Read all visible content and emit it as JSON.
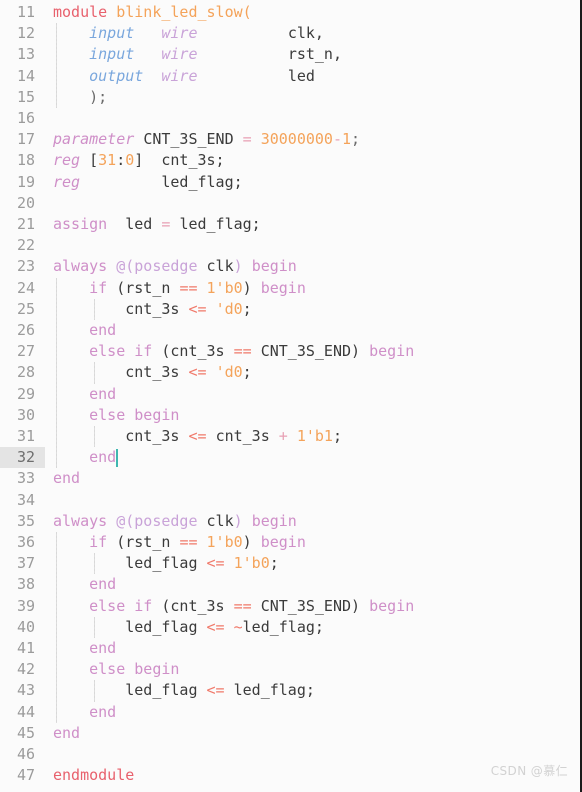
{
  "editor": {
    "language": "verilog",
    "first_line_number": 11,
    "active_line_number": 32,
    "line_height_px": 21.2,
    "background_color": "#fbfbfb",
    "gutter_color": "#fbfbfb",
    "line_number_color": "#9b9b9b",
    "active_line_gutter_color": "#e4e4e4",
    "caret_color": "#3fb7b0",
    "indent_guide_color": "#d8d8d8"
  },
  "palette": {
    "module_keyword": "#e8616d",
    "module_name": "#f4a35a",
    "keyword": "#cf8fc8",
    "declaration": "#cf8fc8",
    "port_direction": "#7aa7dd",
    "net_type": "#c9a3d8",
    "identifier": "#3b3b3b",
    "number": "#f4a35a",
    "operator": "#f0796a",
    "assign_equals": "#e8a0b4",
    "punctuation": "#6a6a6a"
  },
  "watermark": {
    "text": "CSDN @慕仁"
  },
  "lines": [
    {
      "n": 11,
      "text": "module blink_led_slow("
    },
    {
      "n": 12,
      "text": "    input   wire          clk,"
    },
    {
      "n": 13,
      "text": "    input   wire          rst_n,"
    },
    {
      "n": 14,
      "text": "    output  wire          led"
    },
    {
      "n": 15,
      "text": "    );"
    },
    {
      "n": 16,
      "text": ""
    },
    {
      "n": 17,
      "text": "parameter CNT_3S_END = 30000000-1;"
    },
    {
      "n": 18,
      "text": "reg [31:0]  cnt_3s;"
    },
    {
      "n": 19,
      "text": "reg         led_flag;"
    },
    {
      "n": 20,
      "text": ""
    },
    {
      "n": 21,
      "text": "assign  led = led_flag;"
    },
    {
      "n": 22,
      "text": ""
    },
    {
      "n": 23,
      "text": "always @(posedge clk) begin"
    },
    {
      "n": 24,
      "text": "    if (rst_n == 1'b0) begin"
    },
    {
      "n": 25,
      "text": "        cnt_3s <= 'd0;"
    },
    {
      "n": 26,
      "text": "    end"
    },
    {
      "n": 27,
      "text": "    else if (cnt_3s == CNT_3S_END) begin"
    },
    {
      "n": 28,
      "text": "        cnt_3s <= 'd0;"
    },
    {
      "n": 29,
      "text": "    end"
    },
    {
      "n": 30,
      "text": "    else begin"
    },
    {
      "n": 31,
      "text": "        cnt_3s <= cnt_3s + 1'b1;"
    },
    {
      "n": 32,
      "text": "    end"
    },
    {
      "n": 33,
      "text": "end"
    },
    {
      "n": 34,
      "text": ""
    },
    {
      "n": 35,
      "text": "always @(posedge clk) begin"
    },
    {
      "n": 36,
      "text": "    if (rst_n == 1'b0) begin"
    },
    {
      "n": 37,
      "text": "        led_flag <= 1'b0;"
    },
    {
      "n": 38,
      "text": "    end"
    },
    {
      "n": 39,
      "text": "    else if (cnt_3s == CNT_3S_END) begin"
    },
    {
      "n": 40,
      "text": "        led_flag <= ~led_flag;"
    },
    {
      "n": 41,
      "text": "    end"
    },
    {
      "n": 42,
      "text": "    else begin"
    },
    {
      "n": 43,
      "text": "        led_flag <= led_flag;"
    },
    {
      "n": 44,
      "text": "    end"
    },
    {
      "n": 45,
      "text": "end"
    },
    {
      "n": 46,
      "text": ""
    },
    {
      "n": 47,
      "text": "endmodule"
    }
  ],
  "tokens": {
    "11": [
      [
        "module ",
        "k-mod"
      ],
      [
        "blink_led_slow",
        "k-name"
      ],
      [
        "(",
        "k-name"
      ]
    ],
    "12": [
      [
        "    ",
        ""
      ],
      [
        "input",
        "k-port"
      ],
      [
        "   ",
        ""
      ],
      [
        "wire",
        "k-type"
      ],
      [
        "          ",
        ""
      ],
      [
        "clk,",
        "k-id"
      ]
    ],
    "13": [
      [
        "    ",
        ""
      ],
      [
        "input",
        "k-port"
      ],
      [
        "   ",
        ""
      ],
      [
        "wire",
        "k-type"
      ],
      [
        "          ",
        ""
      ],
      [
        "rst_n,",
        "k-id"
      ]
    ],
    "14": [
      [
        "    ",
        ""
      ],
      [
        "output",
        "k-port"
      ],
      [
        "  ",
        ""
      ],
      [
        "wire",
        "k-type"
      ],
      [
        "          ",
        ""
      ],
      [
        "led",
        "k-id"
      ]
    ],
    "15": [
      [
        "    );",
        "k-punct"
      ]
    ],
    "16": [],
    "17": [
      [
        "parameter",
        "k-decl"
      ],
      [
        " ",
        ""
      ],
      [
        "CNT_3S_END",
        "k-id"
      ],
      [
        " ",
        ""
      ],
      [
        "=",
        "k-eq"
      ],
      [
        " ",
        ""
      ],
      [
        "30000000",
        "k-num"
      ],
      [
        "-",
        "k-eq"
      ],
      [
        "1",
        "k-num"
      ],
      [
        ";",
        "k-punct"
      ]
    ],
    "18": [
      [
        "reg",
        "k-decl"
      ],
      [
        " [",
        "k-id"
      ],
      [
        "31",
        "k-num"
      ],
      [
        ":",
        "k-id"
      ],
      [
        "0",
        "k-num"
      ],
      [
        "]",
        "k-id"
      ],
      [
        "  cnt_3s;",
        "k-id"
      ]
    ],
    "19": [
      [
        "reg",
        "k-decl"
      ],
      [
        "         led_flag;",
        "k-id"
      ]
    ],
    "20": [],
    "21": [
      [
        "assign",
        "k-kw"
      ],
      [
        "  ",
        ""
      ],
      [
        "led",
        "k-id"
      ],
      [
        " ",
        ""
      ],
      [
        "=",
        "k-eq"
      ],
      [
        " ",
        ""
      ],
      [
        "led_flag;",
        "k-id"
      ]
    ],
    "22": [],
    "23": [
      [
        "always",
        "k-kw"
      ],
      [
        " ",
        ""
      ],
      [
        "@(",
        "k-edge"
      ],
      [
        "posedge",
        "k-edge"
      ],
      [
        " ",
        ""
      ],
      [
        "clk",
        "k-id"
      ],
      [
        ")",
        "k-edge"
      ],
      [
        " ",
        ""
      ],
      [
        "begin",
        "k-kw"
      ]
    ],
    "24": [
      [
        "    ",
        ""
      ],
      [
        "if",
        "k-kw"
      ],
      [
        " ",
        ""
      ],
      [
        "(",
        "k-id"
      ],
      [
        "rst_n",
        "k-id"
      ],
      [
        " ",
        ""
      ],
      [
        "==",
        "k-op"
      ],
      [
        " ",
        ""
      ],
      [
        "1'b0",
        "k-num"
      ],
      [
        ")",
        "k-id"
      ],
      [
        " ",
        ""
      ],
      [
        "begin",
        "k-kw"
      ]
    ],
    "25": [
      [
        "        ",
        ""
      ],
      [
        "cnt_3s",
        "k-id"
      ],
      [
        " ",
        ""
      ],
      [
        "<=",
        "k-op"
      ],
      [
        " ",
        ""
      ],
      [
        "'d0",
        "k-num"
      ],
      [
        ";",
        "k-id"
      ]
    ],
    "26": [
      [
        "    ",
        ""
      ],
      [
        "end",
        "k-kw"
      ]
    ],
    "27": [
      [
        "    ",
        ""
      ],
      [
        "else",
        "k-kw"
      ],
      [
        " ",
        ""
      ],
      [
        "if",
        "k-kw"
      ],
      [
        " ",
        ""
      ],
      [
        "(",
        "k-id"
      ],
      [
        "cnt_3s",
        "k-id"
      ],
      [
        " ",
        ""
      ],
      [
        "==",
        "k-op"
      ],
      [
        " ",
        ""
      ],
      [
        "CNT_3S_END",
        "k-id"
      ],
      [
        ")",
        "k-id"
      ],
      [
        " ",
        ""
      ],
      [
        "begin",
        "k-kw"
      ]
    ],
    "28": [
      [
        "        ",
        ""
      ],
      [
        "cnt_3s",
        "k-id"
      ],
      [
        " ",
        ""
      ],
      [
        "<=",
        "k-op"
      ],
      [
        " ",
        ""
      ],
      [
        "'d0",
        "k-num"
      ],
      [
        ";",
        "k-id"
      ]
    ],
    "29": [
      [
        "    ",
        ""
      ],
      [
        "end",
        "k-kw"
      ]
    ],
    "30": [
      [
        "    ",
        ""
      ],
      [
        "else",
        "k-kw"
      ],
      [
        " ",
        ""
      ],
      [
        "begin",
        "k-kw"
      ]
    ],
    "31": [
      [
        "        ",
        ""
      ],
      [
        "cnt_3s",
        "k-id"
      ],
      [
        " ",
        ""
      ],
      [
        "<=",
        "k-op"
      ],
      [
        " ",
        ""
      ],
      [
        "cnt_3s",
        "k-id"
      ],
      [
        " ",
        ""
      ],
      [
        "+",
        "k-eq"
      ],
      [
        " ",
        ""
      ],
      [
        "1'b1",
        "k-num"
      ],
      [
        ";",
        "k-id"
      ]
    ],
    "32": [
      [
        "    ",
        ""
      ],
      [
        "end",
        "k-kw"
      ]
    ],
    "33": [
      [
        "end",
        "k-kw"
      ]
    ],
    "34": [],
    "35": [
      [
        "always",
        "k-kw"
      ],
      [
        " ",
        ""
      ],
      [
        "@(",
        "k-edge"
      ],
      [
        "posedge",
        "k-edge"
      ],
      [
        " ",
        ""
      ],
      [
        "clk",
        "k-id"
      ],
      [
        ")",
        "k-edge"
      ],
      [
        " ",
        ""
      ],
      [
        "begin",
        "k-kw"
      ]
    ],
    "36": [
      [
        "    ",
        ""
      ],
      [
        "if",
        "k-kw"
      ],
      [
        " ",
        ""
      ],
      [
        "(",
        "k-id"
      ],
      [
        "rst_n",
        "k-id"
      ],
      [
        " ",
        ""
      ],
      [
        "==",
        "k-op"
      ],
      [
        " ",
        ""
      ],
      [
        "1'b0",
        "k-num"
      ],
      [
        ")",
        "k-id"
      ],
      [
        " ",
        ""
      ],
      [
        "begin",
        "k-kw"
      ]
    ],
    "37": [
      [
        "        ",
        ""
      ],
      [
        "led_flag",
        "k-id"
      ],
      [
        " ",
        ""
      ],
      [
        "<=",
        "k-op"
      ],
      [
        " ",
        ""
      ],
      [
        "1'b0",
        "k-num"
      ],
      [
        ";",
        "k-id"
      ]
    ],
    "38": [
      [
        "    ",
        ""
      ],
      [
        "end",
        "k-kw"
      ]
    ],
    "39": [
      [
        "    ",
        ""
      ],
      [
        "else",
        "k-kw"
      ],
      [
        " ",
        ""
      ],
      [
        "if",
        "k-kw"
      ],
      [
        " ",
        ""
      ],
      [
        "(",
        "k-id"
      ],
      [
        "cnt_3s",
        "k-id"
      ],
      [
        " ",
        ""
      ],
      [
        "==",
        "k-op"
      ],
      [
        " ",
        ""
      ],
      [
        "CNT_3S_END",
        "k-id"
      ],
      [
        ")",
        "k-id"
      ],
      [
        " ",
        ""
      ],
      [
        "begin",
        "k-kw"
      ]
    ],
    "40": [
      [
        "        ",
        ""
      ],
      [
        "led_flag",
        "k-id"
      ],
      [
        " ",
        ""
      ],
      [
        "<=",
        "k-op"
      ],
      [
        " ",
        ""
      ],
      [
        "~",
        "k-op"
      ],
      [
        "led_flag",
        "k-id"
      ],
      [
        ";",
        "k-id"
      ]
    ],
    "41": [
      [
        "    ",
        ""
      ],
      [
        "end",
        "k-kw"
      ]
    ],
    "42": [
      [
        "    ",
        ""
      ],
      [
        "else",
        "k-kw"
      ],
      [
        " ",
        ""
      ],
      [
        "begin",
        "k-kw"
      ]
    ],
    "43": [
      [
        "        ",
        ""
      ],
      [
        "led_flag",
        "k-id"
      ],
      [
        " ",
        ""
      ],
      [
        "<=",
        "k-op"
      ],
      [
        " ",
        ""
      ],
      [
        "led_flag",
        "k-id"
      ],
      [
        ";",
        "k-id"
      ]
    ],
    "44": [
      [
        "    ",
        ""
      ],
      [
        "end",
        "k-kw"
      ]
    ],
    "45": [
      [
        "end",
        "k-kw"
      ]
    ],
    "46": [],
    "47": [
      [
        "endmodule",
        "k-mod"
      ]
    ]
  },
  "indent_guides": [
    {
      "x": 3,
      "top_line": 12,
      "bottom_line": 15
    },
    {
      "x": 3,
      "top_line": 24,
      "bottom_line": 32
    },
    {
      "x": 3,
      "top_line": 36,
      "bottom_line": 44
    },
    {
      "x": 41,
      "top_line": 25,
      "bottom_line": 25
    },
    {
      "x": 41,
      "top_line": 28,
      "bottom_line": 28
    },
    {
      "x": 41,
      "top_line": 31,
      "bottom_line": 31
    },
    {
      "x": 41,
      "top_line": 37,
      "bottom_line": 37
    },
    {
      "x": 41,
      "top_line": 40,
      "bottom_line": 40
    },
    {
      "x": 41,
      "top_line": 43,
      "bottom_line": 43
    }
  ],
  "caret": {
    "line": 32,
    "column": 7
  }
}
